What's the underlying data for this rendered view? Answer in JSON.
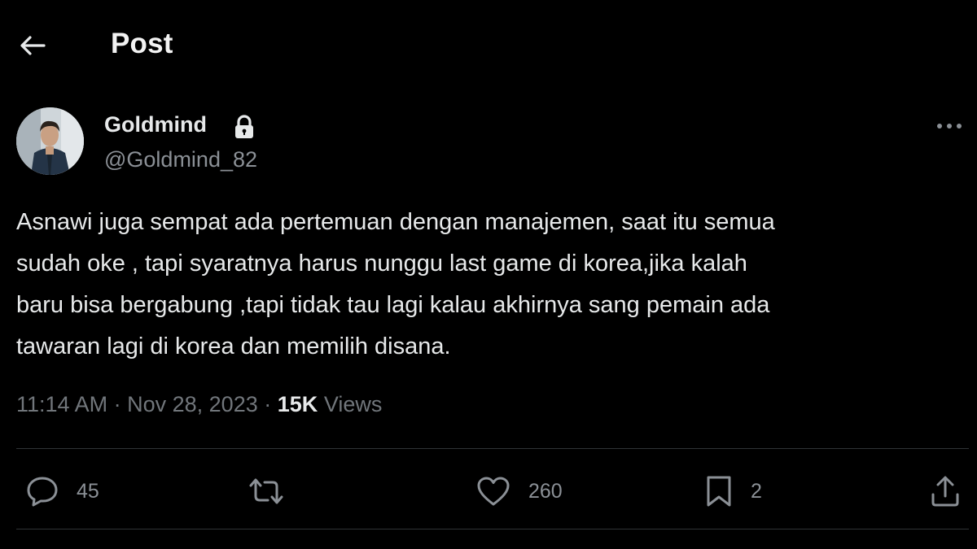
{
  "header": {
    "title": "Post"
  },
  "author": {
    "display_name": "Goldmind",
    "handle": "@Goldmind_82",
    "protected_icon": "lock-icon"
  },
  "tweet": {
    "lines": [
      "Asnawi juga sempat ada pertemuan dengan manajemen, saat itu semua",
      "sudah oke , tapi syaratnya harus nunggu last game di korea,jika kalah",
      "baru bisa bergabung ,tapi tidak tau lagi kalau akhirnya sang pemain ada",
      "tawaran lagi di korea dan memilih disana."
    ],
    "time": "11:14 AM",
    "date": "Nov 28, 2023",
    "views_count": "15K",
    "views_label": "Views",
    "separator": "·"
  },
  "actions": {
    "replies": "45",
    "reposts": "",
    "likes": "260",
    "bookmarks": "2"
  },
  "icons": {
    "back": "arrow-left-icon",
    "more": "more-horizontal-icon",
    "reply": "reply-icon",
    "repost": "repost-icon",
    "like": "heart-icon",
    "bookmark": "bookmark-icon",
    "share": "share-icon"
  },
  "colors": {
    "background": "#000000",
    "text_primary": "#e7e9ea",
    "text_secondary": "#71767b",
    "divider": "#2f3336"
  }
}
